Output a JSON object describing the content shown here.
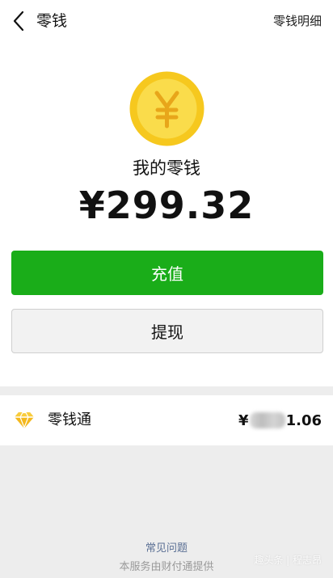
{
  "nav": {
    "title": "零钱",
    "right_link": "零钱明细"
  },
  "wallet": {
    "label": "我的零钱",
    "balance": "¥299.32"
  },
  "actions": {
    "topup_label": "充值",
    "withdraw_label": "提现"
  },
  "lingqiantong": {
    "label": "零钱通",
    "amount_prefix": "¥",
    "amount_suffix": "1.06"
  },
  "footer": {
    "faq": "常见问题",
    "service": "本服务由财付通提供"
  },
  "watermark": "趣头条 | 程志昂",
  "colors": {
    "primary_green": "#1aad19",
    "coin_yellow": "#f6c81e",
    "link_blue": "#5a6f94"
  },
  "icons": {
    "back": "chevron-left-icon",
    "coin": "yuan-coin-icon",
    "lqt": "diamond-icon"
  }
}
